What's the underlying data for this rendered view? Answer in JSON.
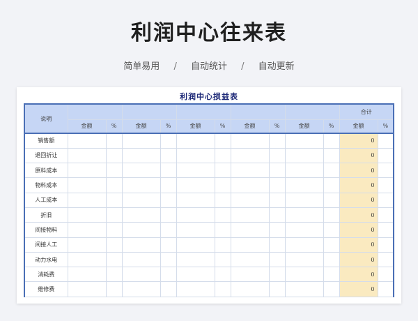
{
  "page": {
    "title": "利润中心往来表",
    "features": [
      "简单易用",
      "自动统计",
      "自动更新"
    ],
    "separator": "/"
  },
  "sheet": {
    "title": "利润中心损益表",
    "header": {
      "description": "说明",
      "group_labels": [
        "",
        "",
        "",
        "",
        "",
        "合计"
      ],
      "amount": "金额",
      "percent": "%"
    },
    "rows": [
      {
        "label": "销售额",
        "total": "0"
      },
      {
        "label": "退回折让",
        "total": "0"
      },
      {
        "label": "原料成本",
        "total": "0"
      },
      {
        "label": "物料成本",
        "total": "0"
      },
      {
        "label": "人工成本",
        "total": "0"
      },
      {
        "label": "折旧",
        "total": "0"
      },
      {
        "label": "间接物料",
        "total": "0"
      },
      {
        "label": "间接人工",
        "total": "0"
      },
      {
        "label": "动力水电",
        "total": "0"
      },
      {
        "label": "消耗费",
        "total": "0"
      },
      {
        "label": "维修费",
        "total": "0"
      }
    ]
  },
  "colors": {
    "header_fill": "#c6d6f5",
    "border_accent": "#4a6fb5",
    "total_fill": "#faeac0",
    "sheet_title": "#1e2a78"
  }
}
